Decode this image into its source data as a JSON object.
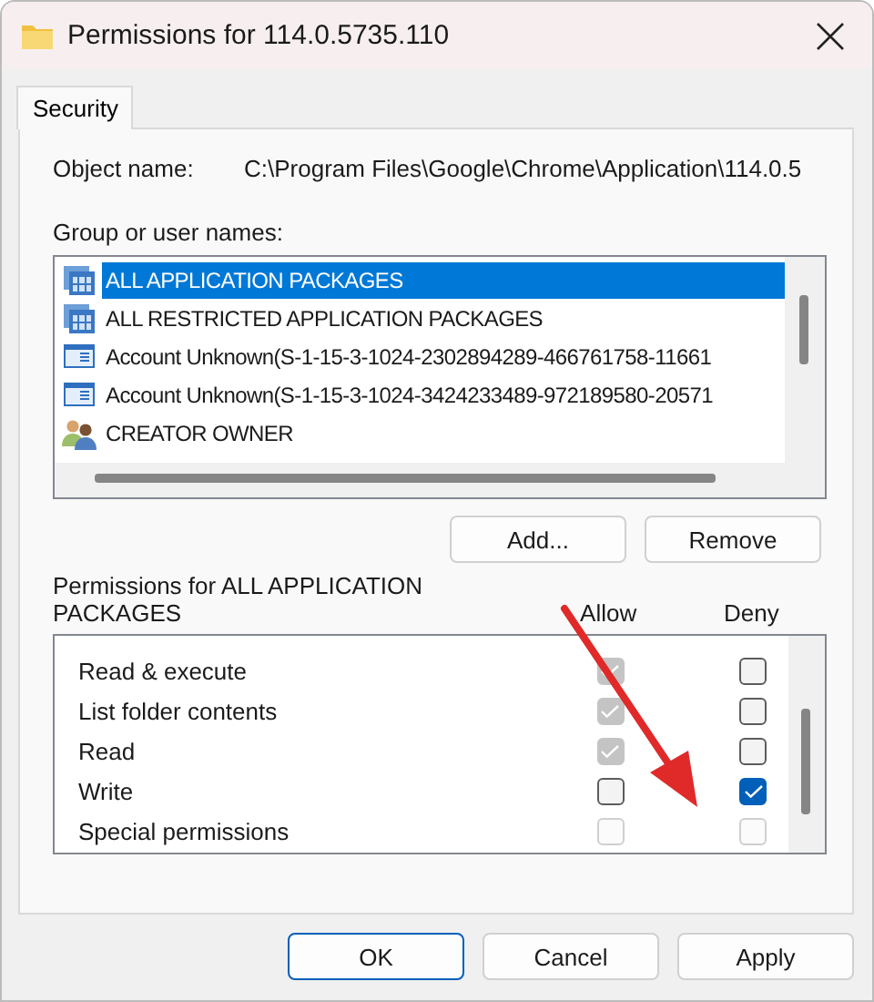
{
  "window": {
    "title": "Permissions for 114.0.5735.110"
  },
  "tabs": [
    {
      "label": "Security",
      "selected": true
    }
  ],
  "object_name": {
    "label": "Object name:",
    "value": "C:\\Program Files\\Google\\Chrome\\Application\\114.0.5"
  },
  "groups": {
    "label": "Group or user names:",
    "items": [
      {
        "name": "ALL APPLICATION PACKAGES",
        "kind": "package",
        "selected": true
      },
      {
        "name": "ALL RESTRICTED APPLICATION PACKAGES",
        "kind": "package",
        "selected": false
      },
      {
        "name": "Account Unknown(S-1-15-3-1024-2302894289-466761758-11661",
        "kind": "account",
        "selected": false
      },
      {
        "name": "Account Unknown(S-1-15-3-1024-3424233489-972189580-20571",
        "kind": "account",
        "selected": false
      },
      {
        "name": "CREATOR OWNER",
        "kind": "users",
        "selected": false
      }
    ]
  },
  "group_buttons": [
    "Add...",
    "Remove"
  ],
  "permissions": {
    "label": "Permissions for ALL APPLICATION PACKAGES",
    "columns": [
      "Allow",
      "Deny"
    ],
    "rows": [
      {
        "name": "Read & execute",
        "allow": {
          "checked": true,
          "disabled": true
        },
        "deny": {
          "checked": false,
          "disabled": false
        }
      },
      {
        "name": "List folder contents",
        "allow": {
          "checked": true,
          "disabled": true
        },
        "deny": {
          "checked": false,
          "disabled": false
        }
      },
      {
        "name": "Read",
        "allow": {
          "checked": true,
          "disabled": true
        },
        "deny": {
          "checked": false,
          "disabled": false
        }
      },
      {
        "name": "Write",
        "allow": {
          "checked": false,
          "disabled": false
        },
        "deny": {
          "checked": true,
          "disabled": false
        }
      },
      {
        "name": "Special permissions",
        "allow": {
          "checked": false,
          "disabled": true
        },
        "deny": {
          "checked": false,
          "disabled": true
        }
      }
    ]
  },
  "buttons": [
    {
      "label": "OK",
      "default": true
    },
    {
      "label": "Cancel",
      "default": false
    },
    {
      "label": "Apply",
      "default": false
    }
  ]
}
